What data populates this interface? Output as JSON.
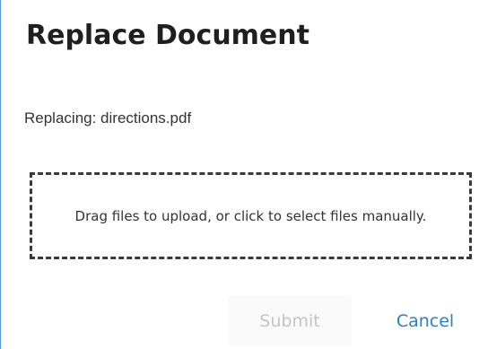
{
  "dialog": {
    "title": "Replace Document",
    "replacing_text": "Replacing: directions.pdf",
    "dropzone_text": "Drag files to upload, or click to select files manually.",
    "buttons": {
      "submit_label": "Submit",
      "submit_state": "disabled",
      "cancel_label": "Cancel"
    },
    "colors": {
      "accent": "#2f7fc1",
      "disabled_text": "#c4c4c4",
      "dropzone_border": "#3a3a3a"
    }
  }
}
